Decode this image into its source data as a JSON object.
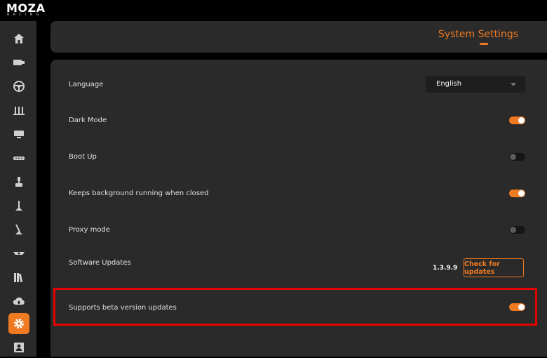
{
  "brand": {
    "name": "MOZA",
    "sub": "RACING"
  },
  "header": {
    "title": "System Settings"
  },
  "sidebar": {
    "items": [
      {
        "icon": "home-icon"
      },
      {
        "icon": "wheelbase-icon"
      },
      {
        "icon": "steering-wheel-icon"
      },
      {
        "icon": "pedals-icon"
      },
      {
        "icon": "dashboard-icon"
      },
      {
        "icon": "shift-lights-icon"
      },
      {
        "icon": "joystick-icon"
      },
      {
        "icon": "handbrake-icon"
      },
      {
        "icon": "shifter-icon"
      },
      {
        "icon": "hub-icon"
      },
      {
        "icon": "library-icon"
      },
      {
        "icon": "cloud-upload-icon"
      },
      {
        "icon": "gear-icon",
        "active": true
      },
      {
        "icon": "account-icon"
      }
    ]
  },
  "settings": {
    "language": {
      "label": "Language",
      "value": "English"
    },
    "dark_mode": {
      "label": "Dark Mode",
      "enabled": true
    },
    "boot_up": {
      "label": "Boot Up",
      "enabled": false
    },
    "background": {
      "label": "Keeps background running when closed",
      "enabled": true
    },
    "proxy": {
      "label": "Proxy mode",
      "enabled": false
    },
    "software_updates": {
      "label": "Software Updates",
      "version": "1.3.9.9",
      "button": "Check for updates"
    },
    "beta": {
      "label": "Supports beta version updates",
      "enabled": true
    }
  },
  "colors": {
    "accent": "#f07a22",
    "highlight": "#e60000",
    "panel": "#2a2a2a"
  }
}
